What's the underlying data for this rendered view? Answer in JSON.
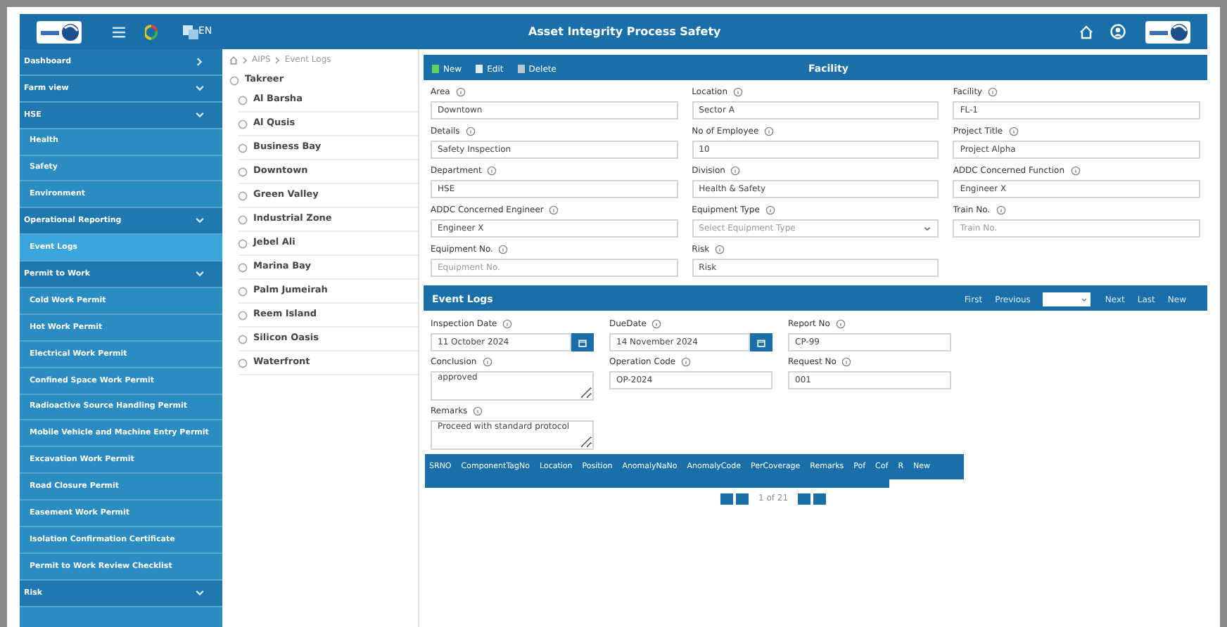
{
  "header": {
    "language": "EN",
    "title": "Asset Integrity Process Safety"
  },
  "sidebar": {
    "items": [
      {
        "label": "Dashboard",
        "kind": "section",
        "expanded": false,
        "selected": false
      },
      {
        "label": "Farm view",
        "kind": "section",
        "expanded": true,
        "selected": false
      },
      {
        "label": "HSE",
        "kind": "section",
        "expanded": true,
        "selected": false
      },
      {
        "label": "Health",
        "kind": "item",
        "selected": false
      },
      {
        "label": "Safety",
        "kind": "item",
        "selected": false
      },
      {
        "label": "Environment",
        "kind": "item",
        "selected": false
      },
      {
        "label": "Operational Reporting",
        "kind": "section",
        "expanded": true,
        "selected": false
      },
      {
        "label": "Event Logs",
        "kind": "item",
        "selected": true
      },
      {
        "label": "Permit to Work",
        "kind": "section",
        "expanded": true,
        "selected": false
      },
      {
        "label": "Cold Work Permit",
        "kind": "item",
        "selected": false
      },
      {
        "label": "Hot Work Permit",
        "kind": "item",
        "selected": false
      },
      {
        "label": "Electrical Work Permit",
        "kind": "item",
        "selected": false
      },
      {
        "label": "Confined Space Work Permit",
        "kind": "item",
        "selected": false
      },
      {
        "label": "Radioactive Source Handling Permit",
        "kind": "item",
        "selected": false
      },
      {
        "label": "Mobile Vehicle and Machine Entry Permit",
        "kind": "item",
        "selected": false
      },
      {
        "label": "Excavation Work Permit",
        "kind": "item",
        "selected": false
      },
      {
        "label": "Road Closure Permit",
        "kind": "item",
        "selected": false
      },
      {
        "label": "Easement Work Permit",
        "kind": "item",
        "selected": false
      },
      {
        "label": "Isolation Confirmation Certificate",
        "kind": "item",
        "selected": false
      },
      {
        "label": "Permit to Work Review Checklist",
        "kind": "item",
        "selected": false
      },
      {
        "label": "Risk",
        "kind": "section",
        "expanded": true,
        "selected": false
      }
    ]
  },
  "breadcrumb": [
    "AIPS",
    "Event Logs"
  ],
  "tree": {
    "label": "Takreer",
    "children": [
      {
        "label": "Al Barsha"
      },
      {
        "label": "Al Qusis"
      },
      {
        "label": "Business Bay"
      },
      {
        "label": "Downtown"
      },
      {
        "label": "Green Valley"
      },
      {
        "label": "Industrial Zone"
      },
      {
        "label": "Jebel Ali"
      },
      {
        "label": "Marina Bay"
      },
      {
        "label": "Palm Jumeirah"
      },
      {
        "label": "Reem Island"
      },
      {
        "label": "Silicon Oasis"
      },
      {
        "label": "Waterfront"
      }
    ]
  },
  "facility": {
    "actions": [
      "New",
      "Edit",
      "Delete"
    ],
    "title": "Facility",
    "fields": [
      {
        "label": "Area",
        "kind": "text",
        "value": "Downtown"
      },
      {
        "label": "Location",
        "kind": "text",
        "value": "Sector A"
      },
      {
        "label": "Facility",
        "kind": "text",
        "value": "FL-1"
      },
      {
        "label": "Details",
        "kind": "text",
        "value": "Safety Inspection"
      },
      {
        "label": "No of Employee",
        "kind": "text",
        "value": "10"
      },
      {
        "label": "Project Title",
        "kind": "text",
        "value": "Project Alpha"
      },
      {
        "label": "Department",
        "kind": "text",
        "value": "HSE"
      },
      {
        "label": "Division",
        "kind": "text",
        "value": "Health & Safety"
      },
      {
        "label": "ADDC Concerned Function",
        "kind": "text",
        "value": "Engineer X"
      },
      {
        "label": "ADDC Concerned Engineer",
        "kind": "text",
        "value": "Engineer X"
      },
      {
        "label": "Equipment Type",
        "kind": "select",
        "placeholder": "Select Equipment Type"
      },
      {
        "label": "Train No.",
        "kind": "text",
        "placeholder": "Train No."
      },
      {
        "label": "Equipment No.",
        "kind": "text",
        "placeholder": "Equipment No."
      },
      {
        "label": "Risk",
        "kind": "text",
        "value": "Risk"
      }
    ]
  },
  "event_logs": {
    "title": "Event Logs",
    "nav": [
      "First",
      "Previous",
      "Next",
      "Last",
      "New"
    ],
    "fields": [
      {
        "label": "Inspection Date",
        "kind": "date",
        "value": "11 October 2024"
      },
      {
        "label": "DueDate",
        "kind": "date",
        "value": "14 November 2024"
      },
      {
        "label": "Report No",
        "kind": "text",
        "value": "CP-99"
      },
      {
        "label": "Conclusion",
        "kind": "textarea",
        "value": "approved"
      },
      {
        "label": "Operation Code",
        "kind": "text",
        "value": "OP-2024"
      },
      {
        "label": "Request No",
        "kind": "text",
        "value": "001"
      },
      {
        "label": "Remarks",
        "kind": "textarea",
        "value": "Proceed with standard protocol"
      }
    ],
    "grid_columns": [
      "SRNO",
      "ComponentTagNo",
      "Location",
      "Position",
      "AnomalyNaNo",
      "AnomalyCode",
      "PerCoverage",
      "Remarks",
      "Pof",
      "Cof",
      "R"
    ],
    "grid_new": "New",
    "pager": "1 of 21"
  }
}
